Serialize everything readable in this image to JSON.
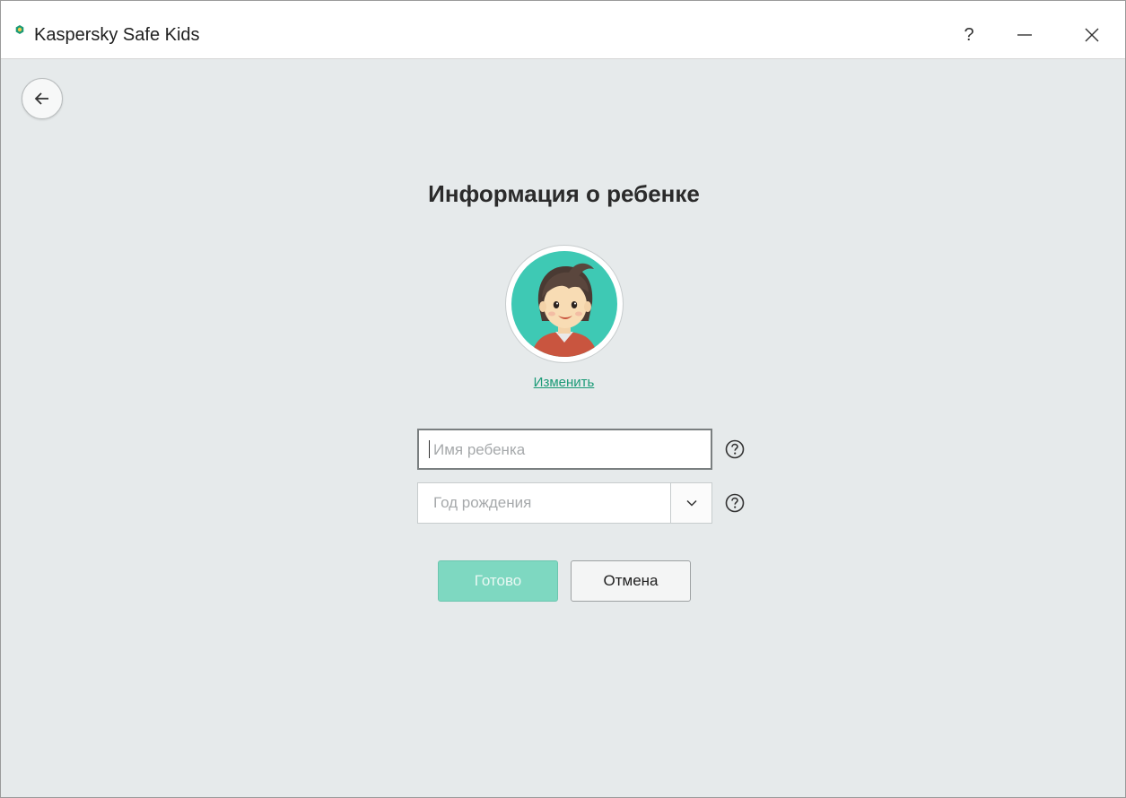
{
  "window": {
    "title": "Kaspersky Safe Kids",
    "help_glyph": "?",
    "controls": [
      "help-icon",
      "minimize-icon",
      "close-icon"
    ]
  },
  "colors": {
    "accent": "#1a9a76",
    "done_button_bg": "#7ed8c1",
    "page_bg": "#e6eaeb",
    "avatar_bg": "#3ec9b4"
  },
  "page": {
    "title": "Информация о ребенке",
    "avatar_icon": "child-avatar",
    "change_link": "Изменить"
  },
  "form": {
    "name_placeholder": "Имя ребенка",
    "name_value": "",
    "year_placeholder": "Год рождения",
    "year_value": ""
  },
  "buttons": {
    "done": "Готово",
    "cancel": "Отмена"
  }
}
